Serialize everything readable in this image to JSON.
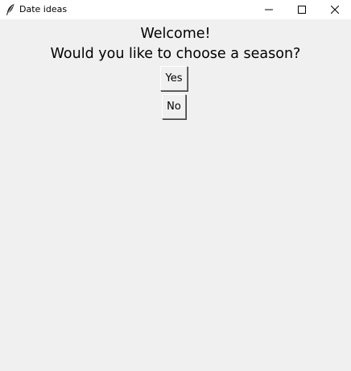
{
  "window": {
    "title": "Date ideas",
    "icon": "feather-icon",
    "controls": {
      "minimize_icon": "minimize-icon",
      "maximize_icon": "maximize-icon",
      "close_icon": "close-icon"
    }
  },
  "main": {
    "welcome_text": "Welcome!",
    "question_text": "Would you like to choose a season?",
    "yes_label": "Yes",
    "no_label": "No"
  },
  "colors": {
    "background": "#f0f0f0",
    "titlebar": "#ffffff",
    "text": "#000000"
  }
}
